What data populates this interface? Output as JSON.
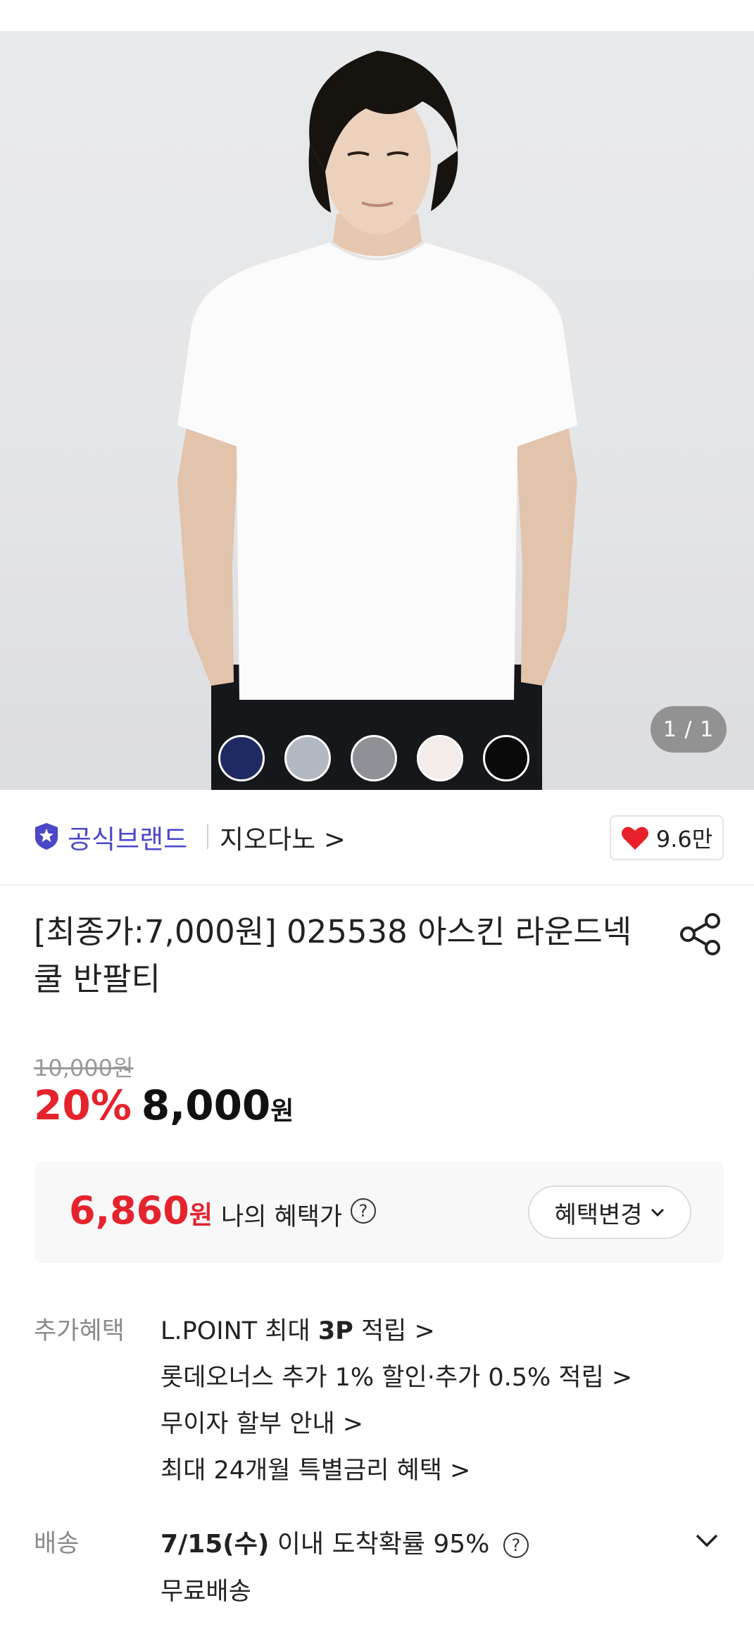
{
  "hero": {
    "pager": "1 / 1",
    "swatches": [
      "#1f2a63",
      "#b3b9c2",
      "#8f9196",
      "#f3ece8",
      "#0a0a0a"
    ]
  },
  "brand": {
    "official_label": "공식브랜드",
    "name": "지오다노 >",
    "likes": "9.6만"
  },
  "product": {
    "title": "[최종가:7,000원] 025538 아스킨 라운드넥 쿨 반팔티",
    "original_price": "10,000원",
    "discount": "20%",
    "price": "8,000",
    "price_unit": "원"
  },
  "benefit": {
    "my_price": "6,860",
    "my_price_unit": "원",
    "my_price_label": "나의 혜택가",
    "help": "?",
    "change_button": "혜택변경"
  },
  "extra_benefits": {
    "label": "추가혜택",
    "lines": [
      {
        "pre": "L.POINT 최대 ",
        "bold": "3P",
        "post": " 적립 >"
      },
      {
        "text": "롯데오너스 추가 1% 할인·추가 0.5% 적립 >"
      },
      {
        "text": "무이자 할부 안내 >"
      },
      {
        "text": "최대 24개월 특별금리 혜택 >"
      }
    ]
  },
  "shipping": {
    "label": "배송",
    "date": "7/15(수)",
    "rest": " 이내 도착확률 95%",
    "help": "?",
    "sub": "무료배송"
  }
}
